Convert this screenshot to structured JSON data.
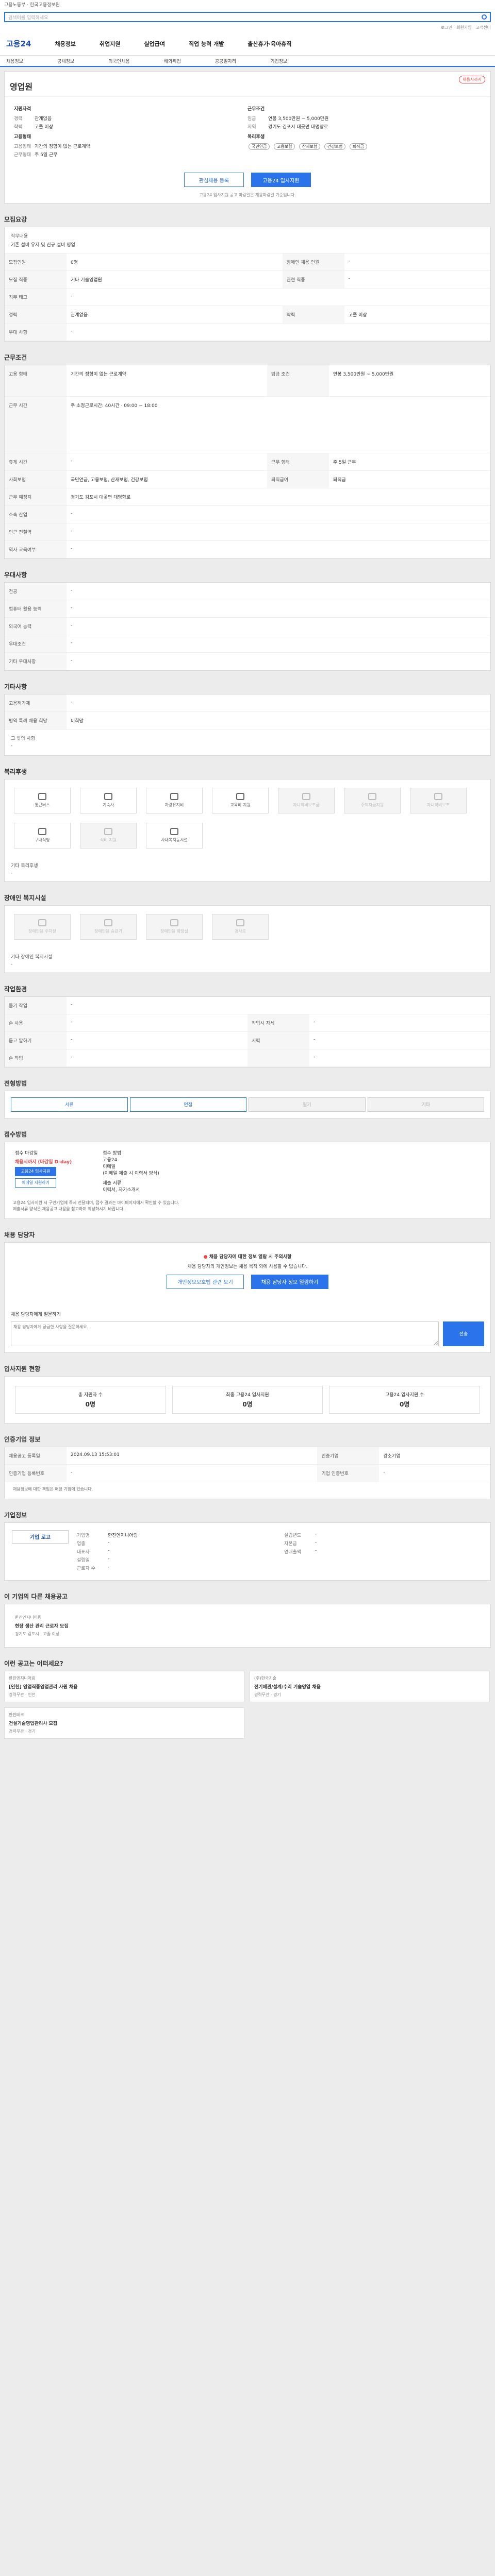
{
  "header": {
    "top_text": "고용노동부 · 한국고용정보원",
    "search_placeholder": "검색어를 입력하세요",
    "right_links": [
      "로그인",
      "회원가입",
      "고객센터"
    ],
    "logo": "고용24",
    "gnb": [
      "채용정보",
      "취업지원",
      "실업급여",
      "직업 능력 개발",
      "출산휴가·육아휴직"
    ],
    "lnb": [
      "채용정보",
      "공채정보",
      "외국인채용",
      "해외취업",
      "공공일자리",
      "기업정보"
    ]
  },
  "job": {
    "badge": "채용시까지",
    "org": "",
    "title": "영업원",
    "left_heading": "지원자격",
    "left": [
      {
        "k": "경력",
        "v": "관계없음"
      },
      {
        "k": "학력",
        "v": "고졸 이상"
      }
    ],
    "right_heading": "근무조건",
    "right": [
      {
        "k": "임금",
        "v": "연봉 3,500만원 ~ 5,000만원"
      },
      {
        "k": "지역",
        "v": "경기도 김포시 대곶면 대명항로"
      }
    ],
    "emp_heading": "고용형태",
    "emp": [
      {
        "k": "고용형태",
        "v": "기간의 정함이 없는 근로계약"
      },
      {
        "k": "근무형태",
        "v": "주 5일 근무"
      }
    ],
    "welfare_heading": "복리후생",
    "welfare_pills": [
      "국민연금",
      "고용보험",
      "산재보험",
      "건강보험",
      "퇴직금"
    ],
    "btn_interest": "관심채용 등록",
    "btn_apply": "고용24 입사지원",
    "notice": "고용24 입사지원 공고 마감일은 채용마감일 기준입니다."
  },
  "sections": {
    "recruit": "모집요강",
    "work": "근무조건",
    "pref": "우대사항",
    "etc": "기타사항",
    "welfare": "복리후생",
    "disabled": "장애인 복지시설",
    "cond": "작업환경",
    "method": "전형방법",
    "receipt": "접수방법",
    "qna": "채용 담당자",
    "stats": "입사지원 현황",
    "period": "인증기업 정보",
    "company": "기업정보",
    "others": "이 기업의 다른 채용공고",
    "recommend": "이런 공고는 어떠세요?"
  },
  "recruit": {
    "duty_label": "직무내용",
    "duty_value": "기존 설비 유지 및 신규 설비 영업",
    "rows": [
      {
        "k": "모집인원",
        "v": "0명",
        "k2": "장애인 채용 인원",
        "v2": "-"
      },
      {
        "k": "모집 직종",
        "v": "기타 기술영업원",
        "k2": "관련 직종",
        "v2": "-"
      },
      {
        "k": "직무 태그",
        "v": "-",
        "k2": "",
        "v2": ""
      },
      {
        "k": "경력",
        "v": "관계없음",
        "k2": "학력",
        "v2": "고졸 이상"
      },
      {
        "k": "우대 사항",
        "v": "-",
        "k2": "",
        "v2": ""
      }
    ]
  },
  "work": {
    "rows": [
      {
        "k": "고용 형태",
        "v": "기간의 정함이 없는 근로계약",
        "k2": "임금 조건",
        "v2": "연봉 3,500만원 ~ 5,000만원"
      },
      {
        "k": "근무 시간",
        "v": "주 소정근로시간: 40시간 · 09:00 ~ 18:00",
        "k2": "",
        "v2": ""
      },
      {
        "k": "휴게 시간",
        "v": "-",
        "k2": "근무 형태",
        "v2": "주 5일 근무"
      },
      {
        "k": "사회보험",
        "v": "국민연금, 고용보험, 산재보험, 건강보험",
        "k2": "퇴직급여",
        "v2": "퇴직금"
      },
      {
        "k": "근무 예정지",
        "v": "경기도 김포시 대곶면 대명항로",
        "k2": "",
        "v2": ""
      },
      {
        "k": "소속 산업",
        "v": "-",
        "k2": "",
        "v2": ""
      },
      {
        "k": "인근 전철역",
        "v": "-",
        "k2": "",
        "v2": ""
      },
      {
        "k": "역사 교육여부",
        "v": "-",
        "k2": "",
        "v2": ""
      }
    ]
  },
  "pref": {
    "rows": [
      {
        "k": "전공",
        "v": "-"
      },
      {
        "k": "컴퓨터 활용 능력",
        "v": "-"
      },
      {
        "k": "외국어 능력",
        "v": "-"
      },
      {
        "k": "우대조건",
        "v": "-"
      },
      {
        "k": "기타 우대사항",
        "v": "-"
      }
    ]
  },
  "etc": {
    "rows": [
      {
        "k": "고용허가제",
        "v": "-"
      },
      {
        "k": "병역 특례 채용 희망",
        "v": "비희망"
      }
    ],
    "extra_label": "그 밖의 사항",
    "extra_value": "-"
  },
  "welfare": {
    "items": [
      {
        "n": "통근버스",
        "on": true
      },
      {
        "n": "기숙사",
        "on": true
      },
      {
        "n": "차량유지비",
        "on": true
      },
      {
        "n": "교육비 지원",
        "on": true
      },
      {
        "n": "자녀학비보조금",
        "on": false
      },
      {
        "n": "주택자금지원",
        "on": false
      },
      {
        "n": "자녀학비보조",
        "on": false
      },
      {
        "n": "구내식당",
        "on": true
      },
      {
        "n": "식비 지원",
        "on": false
      },
      {
        "n": "사내복지동시설",
        "on": true
      }
    ],
    "other_label": "기타 복리후생",
    "other_value": "-"
  },
  "disabled": {
    "items": [
      "장애인용 주차장",
      "장애인용 승강기",
      "장애인용 화장실",
      "경사로"
    ],
    "other_label": "기타 장애인 복지시설",
    "other_value": "-"
  },
  "cond": {
    "rows": [
      {
        "k": "들기 작업",
        "v": "-",
        "k2": "",
        "v2": ""
      },
      {
        "k": "손 사용",
        "v": "-",
        "k2": "작업시 자세",
        "v2": "-"
      },
      {
        "k": "듣고 말하기",
        "v": "-",
        "k2": "시력",
        "v2": "-"
      },
      {
        "k": "손 작업",
        "v": "-",
        "k2": "",
        "v2": "-"
      }
    ]
  },
  "method": {
    "tabs": [
      "서류",
      "면접",
      "필기",
      "기타"
    ]
  },
  "receipt": {
    "label1": "접수 마감일",
    "pre": "채용시까지 (마감일 D-day)",
    "btn_apply": "고용24 입사지원",
    "btn_email": "이메일 지원하기",
    "label2": "접수 방법",
    "l2a": "고용24",
    "l2b": "이메일",
    "l2c": "(이메일 제출 시 이력서 양식)",
    "label3": "제출 서류",
    "l3a": "이력서, 자기소개서",
    "notes": [
      "고용24 입사지원 시 구인기업에 즉시 전달되며, 접수 결과는 마이페이지에서 확인할 수 있습니다.",
      "제출서류 양식은 채용공고 내용을 참고하여 작성하시기 바랍니다."
    ]
  },
  "qna": {
    "alert_title": "채용 담당자에 대한 정보 열람 시 주의사항",
    "alert_body": "채용 담당자의 개인정보는 채용 목적 외에 사용할 수 없습니다.",
    "btn1": "개인정보보호법 관련 보기",
    "btn2": "채용 담당자 정보 열람하기",
    "ask_label": "채용 담당자에게 질문하기",
    "ask_placeholder": "채용 담당자에게 궁금한 사항을 질문하세요.",
    "send": "전송"
  },
  "stats": {
    "more": "더보기 >",
    "items": [
      {
        "t": "총 지원자 수",
        "v": "0명"
      },
      {
        "t": "최종 고용24 입사지원",
        "v": "0명"
      },
      {
        "t": "고용24 입사지원 수",
        "v": "0명"
      }
    ]
  },
  "period": {
    "rows": [
      {
        "k": "채용공고 등록일",
        "v": "2024.09.13 15:53:01",
        "k2": "인증기업",
        "v2": "강소기업"
      },
      {
        "k": "인증기업 등록번호",
        "v": "-",
        "k2": "기업 인증번호",
        "v2": "-"
      }
    ],
    "notes": [
      "채용정보에 대한 책임은 해당 기업에 있습니다."
    ]
  },
  "company": {
    "logo": "기업 로고",
    "rows": [
      {
        "k": "기업명",
        "v": "한진엔지니어링"
      },
      {
        "k": "업종",
        "v": "-"
      },
      {
        "k": "대표자",
        "v": "-"
      },
      {
        "k": "설립일",
        "v": "-"
      },
      {
        "k": "근로자 수",
        "v": "-"
      }
    ],
    "right": [
      {
        "k": "설립년도",
        "v": "-"
      },
      {
        "k": "자본금",
        "v": "-"
      },
      {
        "k": "연매출액",
        "v": "-"
      }
    ]
  },
  "others": {
    "items": [
      {
        "cn": "한진엔지니어링",
        "tt": "현장 생산 관리 근로자 모집",
        "mt": "경기도 김포시 · 고졸 이상"
      }
    ]
  },
  "recommend": {
    "items": [
      {
        "cn": "한진엔지니어링",
        "tt": "[인천] 영업직종영업관리 사원 채용",
        "mt": "경력무관 · 인천"
      },
      {
        "cn": "(주)한국기술",
        "tt": "전기배관/설계/수리 기술영업 채용",
        "mt": "경력무관 · 경기"
      },
      {
        "cn": "한진테크",
        "tt": "건설기술영업관리사 모집",
        "mt": "경력무관 · 경기"
      }
    ]
  }
}
